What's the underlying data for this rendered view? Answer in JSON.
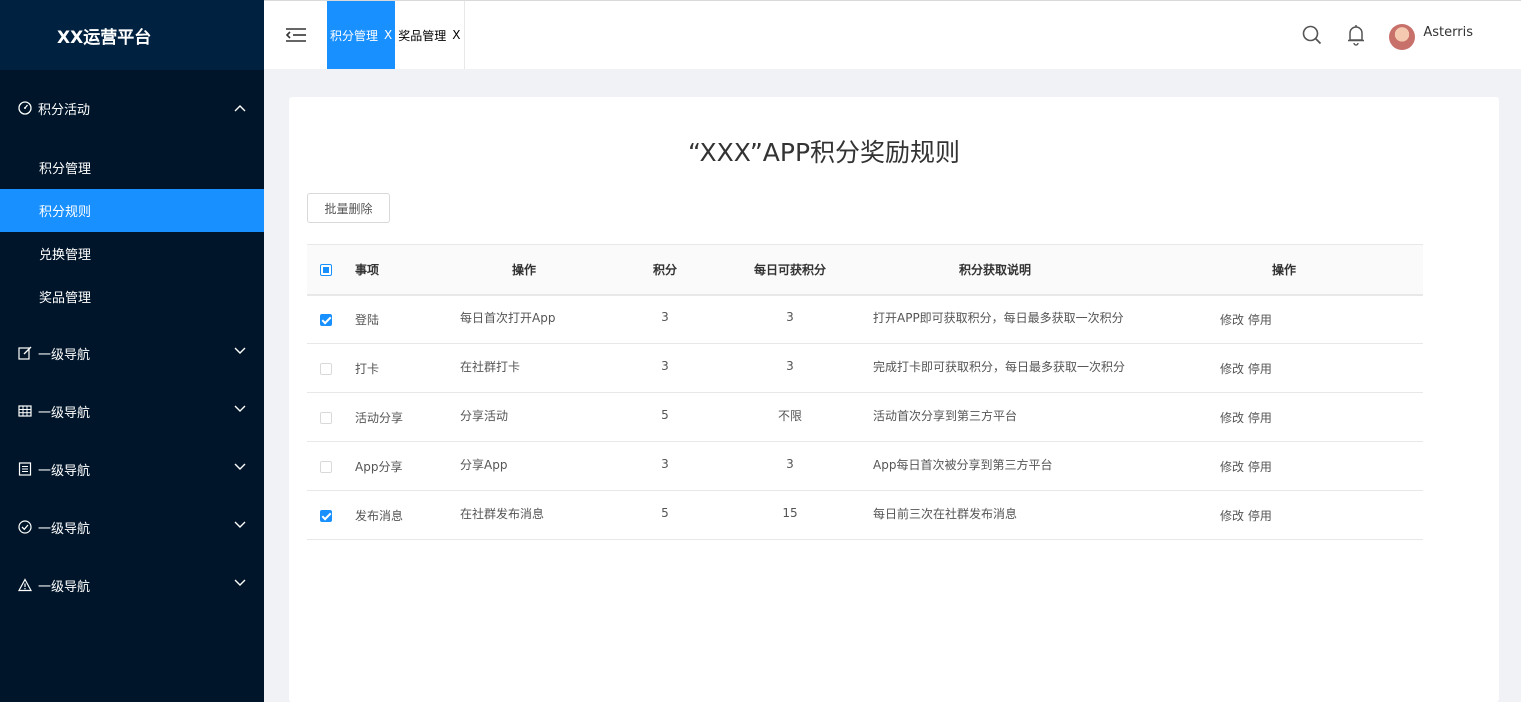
{
  "app": {
    "title": "XX运营平台"
  },
  "sidebar": {
    "group": {
      "label": "积分活动",
      "icon": "dashboard-icon",
      "expanded": true
    },
    "sub_items": [
      {
        "label": "积分管理",
        "active": false
      },
      {
        "label": "积分规则",
        "active": true
      },
      {
        "label": "兑换管理",
        "active": false
      },
      {
        "label": "奖品管理",
        "active": false
      }
    ],
    "nav_items": [
      {
        "label": "一级导航",
        "icon": "edit-icon"
      },
      {
        "label": "一级导航",
        "icon": "table-icon"
      },
      {
        "label": "一级导航",
        "icon": "list-icon"
      },
      {
        "label": "一级导航",
        "icon": "check-circle-icon"
      },
      {
        "label": "一级导航",
        "icon": "warning-icon"
      }
    ]
  },
  "header": {
    "tabs": [
      {
        "label": "积分管理",
        "close": "X",
        "active": true
      },
      {
        "label": "奖品管理",
        "close": "X",
        "active": false
      }
    ],
    "user": {
      "name": "Asterris"
    }
  },
  "main": {
    "title": "“XXX”APP积分奖励规则",
    "batch_delete_label": "批量删除",
    "columns": [
      "事项",
      "操作",
      "积分",
      "每日可获积分",
      "积分获取说明",
      "操作"
    ],
    "rows": [
      {
        "checked": true,
        "item": "登陆",
        "operation": "每日首次打开App",
        "points": "3",
        "daily": "3",
        "desc": "打开APP即可获取积分，每日最多获取一次积分",
        "edit": "修改",
        "disable": "停用"
      },
      {
        "checked": false,
        "item": "打卡",
        "operation": "在社群打卡",
        "points": "3",
        "daily": "3",
        "desc": "完成打卡即可获取积分，每日最多获取一次积分",
        "edit": "修改",
        "disable": "停用"
      },
      {
        "checked": false,
        "item": "活动分享",
        "operation": "分享活动",
        "points": "5",
        "daily": "不限",
        "desc": "活动首次分享到第三方平台",
        "edit": "修改",
        "disable": "停用"
      },
      {
        "checked": false,
        "item": "App分享",
        "operation": "分享App",
        "points": "3",
        "daily": "3",
        "desc": "App每日首次被分享到第三方平台",
        "edit": "修改",
        "disable": "停用"
      },
      {
        "checked": true,
        "item": "发布消息",
        "operation": "在社群发布消息",
        "points": "5",
        "daily": "15",
        "desc": "每日前三次在社群发布消息",
        "edit": "修改",
        "disable": "停用"
      }
    ]
  },
  "colors": {
    "sidebar_bg": "#001529",
    "logo_bg": "#002140",
    "accent": "#1890ff",
    "page_bg": "#f0f2f5"
  }
}
